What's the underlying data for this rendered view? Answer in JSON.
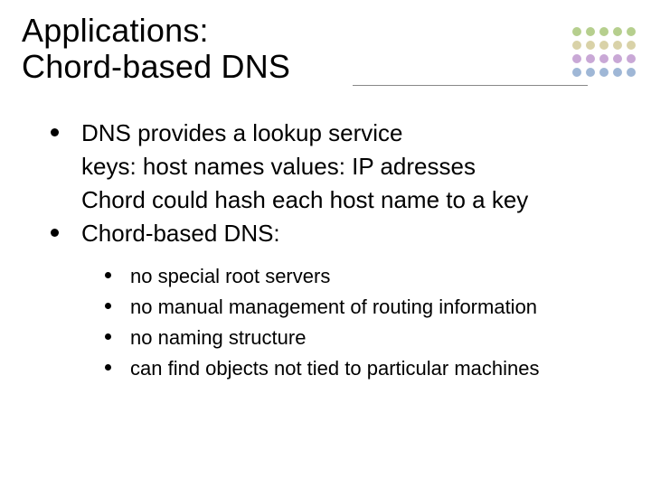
{
  "title": {
    "line1": "Applications:",
    "line2": "Chord-based DNS"
  },
  "body": {
    "items": [
      "DNS provides a lookup service",
      "Chord-based DNS:"
    ],
    "cont": [
      "keys: host names values: IP adresses",
      "Chord could hash each host name to a key"
    ],
    "sub": [
      "no special root servers",
      "no manual management of routing information",
      "no naming structure",
      "can find objects not tied to particular machines"
    ]
  },
  "dots": [
    "background:#b6cf8e",
    "background:#b6cf8e",
    "background:#b6cf8e",
    "background:#b6cf8e",
    "background:#b6cf8e",
    "background:#d9d2a8",
    "background:#d9d2a8",
    "background:#d9d2a8",
    "background:#d9d2a8",
    "background:#d9d2a8",
    "background:#c9a8d6",
    "background:#c9a8d6",
    "background:#c9a8d6",
    "background:#c9a8d6",
    "background:#c9a8d6",
    "background:#9fb7d6",
    "background:#9fb7d6",
    "background:#9fb7d6",
    "background:#9fb7d6",
    "background:#9fb7d6"
  ]
}
